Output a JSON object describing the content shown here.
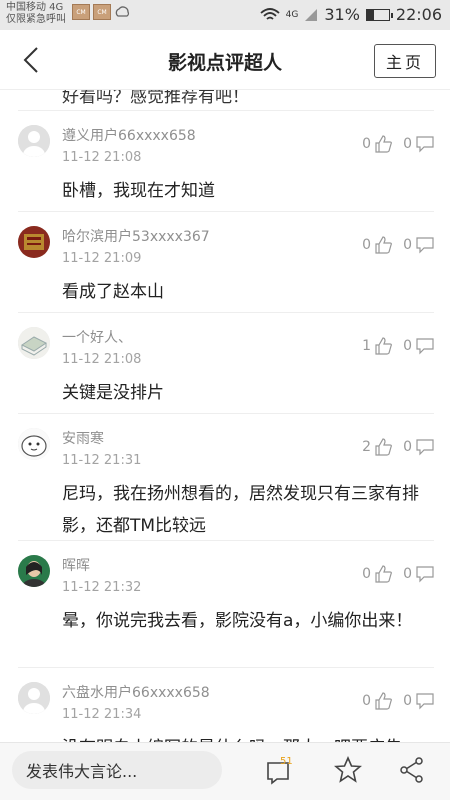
{
  "status": {
    "carrier": "中国移动 4G",
    "emergency": "仅限紧急呼叫",
    "network": "4G",
    "battery": "31%",
    "battery_level": 0.31,
    "time": "22:06"
  },
  "header": {
    "title": "影视点评超人",
    "home_label": "主页"
  },
  "partial_text": "好看吗？感觉推荐有吧！",
  "comments": [
    {
      "user": "遵义用户66xxxx658",
      "time": "11-12 21:08",
      "text": "卧槽，我现在才知道",
      "likes": "0",
      "replies": "0"
    },
    {
      "user": "哈尔滨用户53xxxx367",
      "time": "11-12 21:09",
      "text": "看成了赵本山",
      "likes": "0",
      "replies": "0"
    },
    {
      "user": "一个好人、",
      "time": "11-12 21:08",
      "text": "关键是没排片",
      "likes": "1",
      "replies": "0"
    },
    {
      "user": "安雨寒",
      "time": "11-12 21:31",
      "text": "尼玛，我在扬州想看的，居然发现只有三家有排影，还都TM比较远",
      "likes": "2",
      "replies": "0"
    },
    {
      "user": "晖晖",
      "time": "11-12 21:32",
      "text": "晕，你说完我去看，影院没有a，小编你出来！",
      "likes": "0",
      "replies": "0"
    },
    {
      "user": "六盘水用户66xxxx658",
      "time": "11-12 21:34",
      "text": "没有明白小编写的是什么吗，那大…吧要广告",
      "likes": "0",
      "replies": "0"
    }
  ],
  "bottom": {
    "input_placeholder": "发表伟大言论...",
    "comment_count": "51"
  }
}
